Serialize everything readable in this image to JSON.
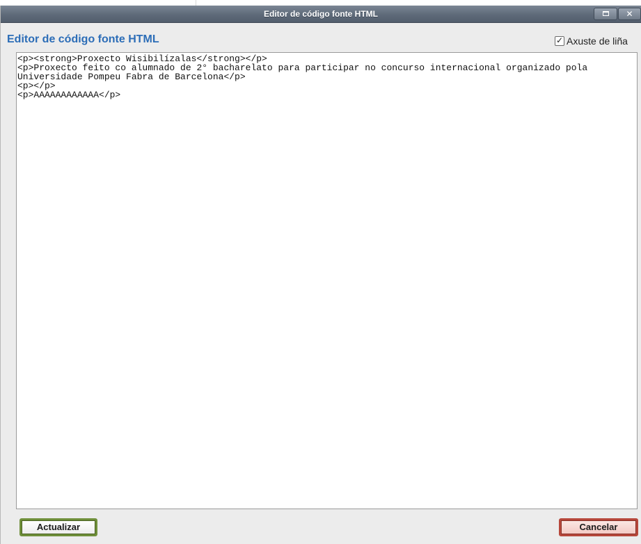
{
  "window": {
    "title": "Editor de código fonte HTML",
    "maximize_icon": "maximize-icon",
    "close_icon": "close-icon",
    "close_glyph": "✕"
  },
  "header": {
    "heading": "Editor de código fonte HTML",
    "wrap_toggle": {
      "label": "Axuste de liña",
      "checked": true,
      "check_glyph": "✓"
    }
  },
  "editor": {
    "content": "<p><strong>Proxecto Wisibilízalas</strong></p>\n<p>Proxecto feito co alumnado de 2° bacharelato para participar no concurso internacional organizado pola Universidade Pompeu Fabra de Barcelona</p>\n<p></p>\n<p>AAAAAAAAAAAA</p>"
  },
  "footer": {
    "update_label": "Actualizar",
    "cancel_label": "Cancelar"
  },
  "colors": {
    "titlebar": "#5e6a79",
    "heading": "#2c6db7",
    "update_border": "#6f8f3a",
    "cancel_border": "#b6473b"
  }
}
